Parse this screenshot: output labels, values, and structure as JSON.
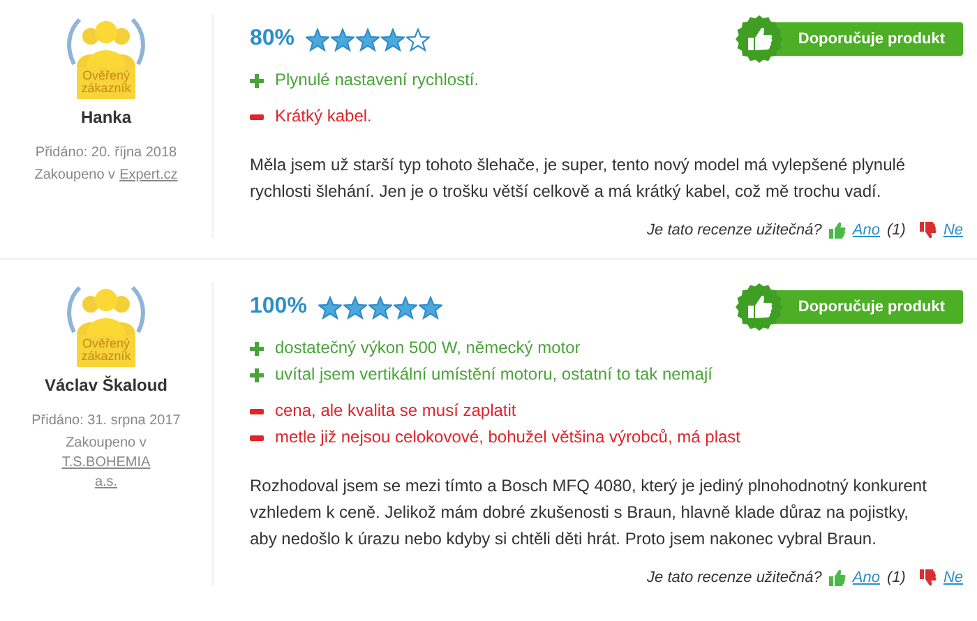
{
  "reviews": [
    {
      "badge": "Ověřený zákazník",
      "name": "Hanka",
      "added": "Přidáno: 20. října 2018",
      "bought_label": "Zakoupeno v",
      "store": "Expert.cz",
      "rating": "80%",
      "stars": 4,
      "recommend": "Doporučuje produkt",
      "points": [
        {
          "kind": "pro",
          "text": "Plynulé nastavení rychlostí."
        },
        {
          "kind": "con",
          "text": "Krátký kabel."
        }
      ],
      "text": "Měla jsem už starší typ tohoto šlehače, je super, tento nový model má vylepšené plynulé rychlosti šlehání. Jen je o trošku větší celkově a má krátký kabel, což mě trochu vadí.",
      "helpful": {
        "question": "Je tato recenze užitečná?",
        "yes": "Ano",
        "yes_count": "(1)",
        "no": "Ne"
      }
    },
    {
      "badge": "Ověřený zákazník",
      "name": "Václav Škaloud",
      "added": "Přidáno: 31. srpna 2017",
      "bought_label": "Zakoupeno v",
      "store": "T.S.BOHEMIA a.s.",
      "rating": "100%",
      "stars": 5,
      "recommend": "Doporučuje produkt",
      "points": [
        {
          "kind": "pro",
          "text": "dostatečný výkon 500 W, německý motor"
        },
        {
          "kind": "pro",
          "text": "uvítal jsem vertikální umístění motoru, ostatní to tak nemají"
        },
        {
          "kind": "con",
          "text": "cena, ale kvalita se musí zaplatit"
        },
        {
          "kind": "con",
          "text": "metle již nejsou celokovové, bohužel většina výrobců, má plast"
        }
      ],
      "text": "Rozhodoval jsem se mezi tímto a Bosch MFQ 4080, který je jediný plnohodnotný konkurent vzhledem k ceně. Jelikož mám dobré zkušenosti s Braun, hlavně klade důraz na pojistky, aby nedošlo k úrazu nebo kdyby si chtěli děti hrát. Proto jsem nakonec vybral Braun.",
      "helpful": {
        "question": "Je tato recenze užitečná?",
        "yes": "Ano",
        "yes_count": "(1)",
        "no": "Ne"
      }
    }
  ]
}
